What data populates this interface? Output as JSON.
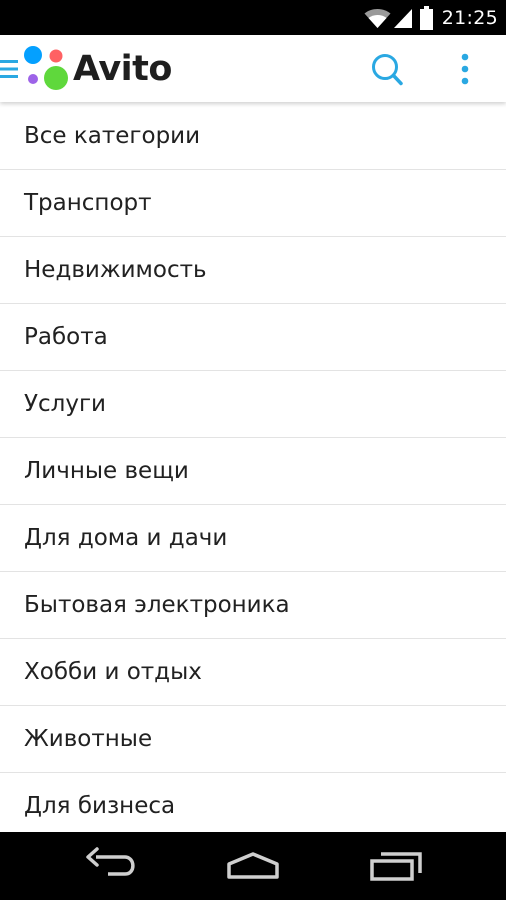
{
  "status_bar": {
    "time": "21:25",
    "icons": [
      "wifi-icon",
      "signal-icon",
      "battery-icon"
    ]
  },
  "app_bar": {
    "title": "Avito",
    "icons": [
      "hamburger-menu-icon",
      "avito-logo-icon",
      "search-icon",
      "more-vert-icon"
    ],
    "accent_color": "#2aa8e2",
    "logo_colors": {
      "blue": "#04a0ff",
      "red": "#ff6163",
      "purple": "#9d63e8",
      "green": "#5fd83c"
    }
  },
  "categories": [
    {
      "label": "Все категории"
    },
    {
      "label": "Транспорт"
    },
    {
      "label": "Недвижимость"
    },
    {
      "label": "Работа"
    },
    {
      "label": "Услуги"
    },
    {
      "label": "Личные вещи"
    },
    {
      "label": "Для дома и дачи"
    },
    {
      "label": "Бытовая электроника"
    },
    {
      "label": "Хобби и отдых"
    },
    {
      "label": "Животные"
    },
    {
      "label": "Для бизнеса"
    }
  ],
  "nav_bar": {
    "icons": [
      "back-icon",
      "home-icon",
      "recent-apps-icon"
    ]
  }
}
